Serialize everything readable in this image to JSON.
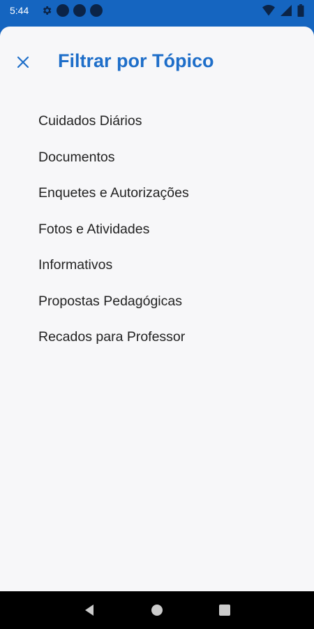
{
  "status_bar": {
    "time": "5:44",
    "icons": [
      "gear-icon",
      "notification-dot",
      "notification-dot",
      "notification-dot",
      "wifi-icon",
      "signal-icon",
      "battery-icon"
    ]
  },
  "header": {
    "close_icon": "close-icon",
    "title": "Filtrar por Tópico"
  },
  "topics": [
    "Cuidados Diários",
    "Documentos",
    "Enquetes e Autorizações",
    "Fotos e Atividades",
    "Informativos",
    "Propostas Pedagógicas",
    "Recados para Professor"
  ],
  "nav_bar": {
    "icons": [
      "back-icon",
      "home-icon",
      "recents-icon"
    ]
  },
  "colors": {
    "accent": "#1e6ec9",
    "status_bar": "#1565C0",
    "sheet": "#f7f7f9"
  }
}
